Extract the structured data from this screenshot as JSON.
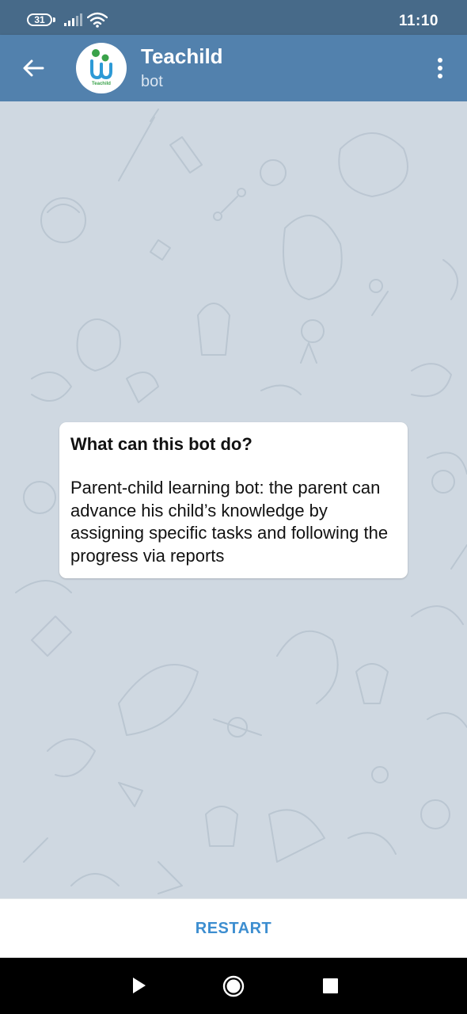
{
  "status_bar": {
    "battery_level": "31",
    "time": "11:10"
  },
  "header": {
    "title": "Teachild",
    "subtitle": "bot",
    "avatar_label": "Teachild",
    "back_icon": "arrow-left-icon",
    "menu_icon": "more-vertical-icon"
  },
  "info_card": {
    "title": "What can this bot do?",
    "description": "Parent-child learning bot: the parent can advance his child’s knowledge by assigning specific tasks and following the progress via reports"
  },
  "bottom_bar": {
    "restart_label": "RESTART"
  },
  "nav_bar": {
    "back_icon": "triangle-back-icon",
    "home_icon": "circle-home-icon",
    "recents_icon": "square-recents-icon"
  },
  "colors": {
    "status_bar": "#476a89",
    "header": "#5281ad",
    "chat_background": "#cfd8e1",
    "accent": "#3d8ed0"
  }
}
